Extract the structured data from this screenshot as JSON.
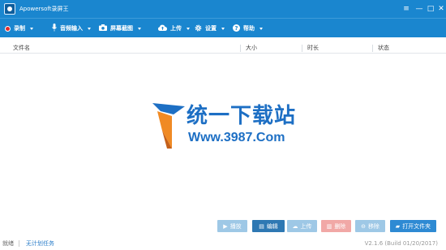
{
  "window": {
    "title": "Apowersoft录屏王",
    "controls": {
      "menu": "≡",
      "minimize": "—",
      "maximize": "□",
      "close": "✕"
    }
  },
  "toolbar": {
    "items": [
      {
        "label": "录制",
        "icon": "record-dot-icon"
      },
      {
        "label": "音频输入",
        "icon": "microphone-icon"
      },
      {
        "label": "屏幕截图",
        "icon": "camera-icon"
      },
      {
        "label": "上传",
        "icon": "cloud-upload-icon"
      },
      {
        "label": "设置",
        "icon": "gear-icon"
      },
      {
        "label": "帮助",
        "icon": "help-icon"
      }
    ]
  },
  "table": {
    "columns": [
      "文件名",
      "大小",
      "时长",
      "状态"
    ],
    "rows": []
  },
  "watermark": {
    "text": "统一下载站",
    "url": "Www.3987.Com"
  },
  "actions": {
    "play": "播放",
    "edit": "编辑",
    "upload": "上传",
    "delete": "删除",
    "remove": "移除",
    "open_folder": "打开文件夹"
  },
  "status": {
    "state": "就绪",
    "task_link": "无计划任务",
    "version": "V2.1.6 (Build 01/20/2017)"
  },
  "colors": {
    "accent": "#1a86cf",
    "button_active": "#2e78b3",
    "button_disabled": "#9ec8e6",
    "button_delete": "#f1a8a6",
    "link": "#2a7dc9"
  }
}
